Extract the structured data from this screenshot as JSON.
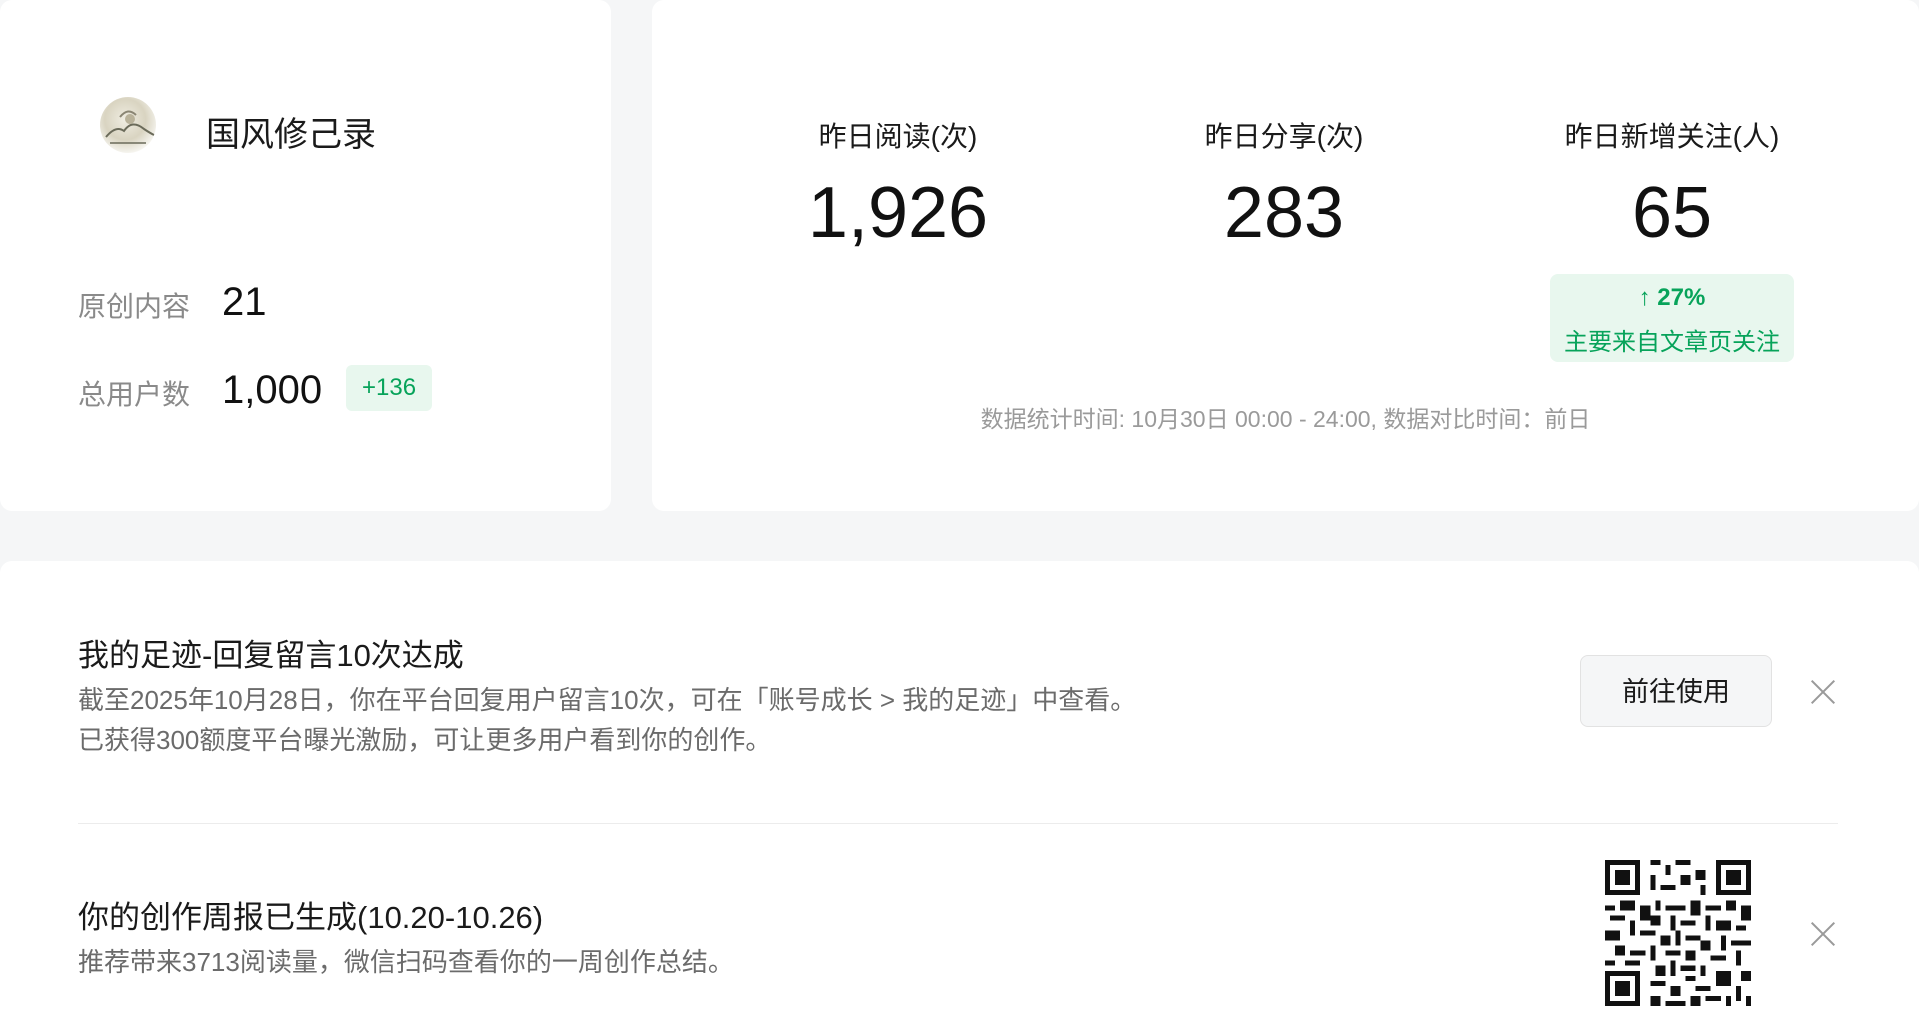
{
  "account": {
    "name": "国风修己录",
    "avatar_icon": "landscape-avatar-icon"
  },
  "metrics": {
    "original_label": "原创内容",
    "original_value": "21",
    "users_label": "总用户数",
    "users_value": "1,000",
    "users_delta": "+136"
  },
  "stats": {
    "reads_label": "昨日阅读(次)",
    "reads_value": "1,926",
    "shares_label": "昨日分享(次)",
    "shares_value": "283",
    "follows_label": "昨日新增关注(人)",
    "follows_value": "65",
    "follows_trend": "↑ 27%",
    "follows_trend_desc": "主要来自文章页关注",
    "note": "数据统计时间: 10月30日 00:00 - 24:00, 数据对比时间：前日"
  },
  "notifications": [
    {
      "title": "我的足迹-回复留言10次达成",
      "line1": "截至2025年10月28日，你在平台回复用户留言10次，可在「账号成长 > 我的足迹」中查看。",
      "line2": "已获得300额度平台曝光激励，可让更多用户看到你的创作。",
      "action_label": "前往使用"
    },
    {
      "title": "你的创作周报已生成(10.20-10.26)",
      "line1": "推荐带来3713阅读量，微信扫码查看你的一周创作总结。"
    }
  ],
  "colors": {
    "accent_green": "#07a35a",
    "badge_green_bg": "#e8f7ee",
    "page_bg": "#f5f6f7"
  }
}
